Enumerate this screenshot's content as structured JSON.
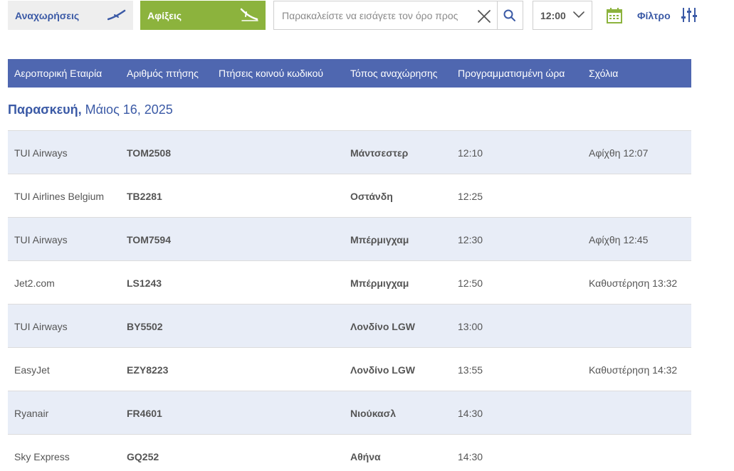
{
  "tabs": {
    "departures": "Αναχωρήσεις",
    "arrivals": "Αφίξεις"
  },
  "search": {
    "placeholder": "Παρακαλείστε να εισάγετε τον όρο προς"
  },
  "time_select": {
    "value": "12:00"
  },
  "filter": {
    "label": "Φίλτρο"
  },
  "table_header": {
    "airline": "Αεροπορική Εταιρία",
    "flight_number": "Αριθμός πτήσης",
    "codeshare": "Πτήσεις κοινού κωδικού",
    "origin": "Τόπος αναχώρησης",
    "scheduled_time": "Προγραμματισμένη ώρα",
    "remarks": "Σχόλια"
  },
  "date": {
    "weekday": "Παρασκευή,",
    "date": "Μάιος 16, 2025"
  },
  "flights": [
    {
      "airline": "TUI Airways",
      "number": "TOM2508",
      "codeshare": "",
      "origin": "Μάντσεστερ",
      "time": "12:10",
      "remark": "Αφίχθη 12:07"
    },
    {
      "airline": "TUI Airlines Belgium",
      "number": "TB2281",
      "codeshare": "",
      "origin": "Οστάνδη",
      "time": "12:25",
      "remark": ""
    },
    {
      "airline": "TUI Airways",
      "number": "TOM7594",
      "codeshare": "",
      "origin": "Μπέρμιγχαμ",
      "time": "12:30",
      "remark": "Αφίχθη 12:45"
    },
    {
      "airline": "Jet2.com",
      "number": "LS1243",
      "codeshare": "",
      "origin": "Μπέρμιγχαμ",
      "time": "12:50",
      "remark": "Καθυστέρηση 13:32"
    },
    {
      "airline": "TUI Airways",
      "number": "BY5502",
      "codeshare": "",
      "origin": "Λονδίνο LGW",
      "time": "13:00",
      "remark": ""
    },
    {
      "airline": "EasyJet",
      "number": "EZY8223",
      "codeshare": "",
      "origin": "Λονδίνο LGW",
      "time": "13:55",
      "remark": "Καθυστέρηση 14:32"
    },
    {
      "airline": "Ryanair",
      "number": "FR4601",
      "codeshare": "",
      "origin": "Νιούκασλ",
      "time": "14:30",
      "remark": ""
    },
    {
      "airline": "Sky Express",
      "number": "GQ252",
      "codeshare": "",
      "origin": "Αθήνα",
      "time": "14:30",
      "remark": ""
    }
  ],
  "colors": {
    "brand_blue": "#3b5aa6",
    "header_blue": "#4f67b0",
    "arrivals_green": "#8cb33d",
    "row_alt": "#e8edf7"
  },
  "icons": {
    "departures": "plane-takeoff-icon",
    "arrivals": "plane-landing-icon",
    "clear": "close-icon",
    "search": "search-icon",
    "time": "chevron-down-icon",
    "calendar": "calendar-icon",
    "filter": "sliders-icon"
  }
}
